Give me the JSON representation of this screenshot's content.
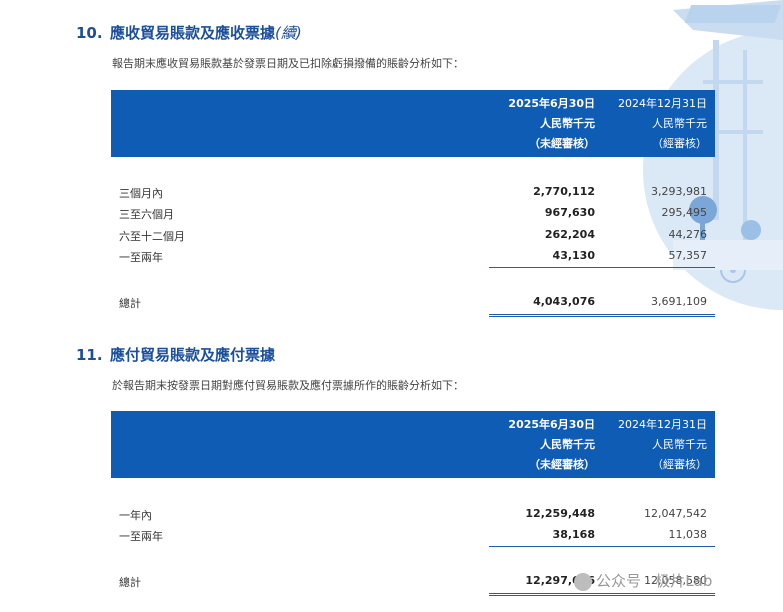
{
  "section10": {
    "number": "10.",
    "title": "應收貿易賬款及應收票據",
    "continued": "(續)",
    "intro": "報告期末應收貿易賬款基於發票日期及已扣除虧損撥備的賬齡分析如下：",
    "header": {
      "col1": [
        "2025年6月30日",
        "人民幣千元",
        "（未經審核）"
      ],
      "col2": [
        "2024年12月31日",
        "人民幣千元",
        "（經審核）"
      ]
    },
    "rows": [
      {
        "label": "三個月內",
        "v1": "2,770,112",
        "v2": "3,293,981"
      },
      {
        "label": "三至六個月",
        "v1": "967,630",
        "v2": "295,495"
      },
      {
        "label": "六至十二個月",
        "v1": "262,204",
        "v2": "44,276"
      },
      {
        "label": "一至兩年",
        "v1": "43,130",
        "v2": "57,357"
      }
    ],
    "total": {
      "label": "總計",
      "v1": "4,043,076",
      "v2": "3,691,109"
    }
  },
  "section11": {
    "number": "11.",
    "title": "應付貿易賬款及應付票據",
    "intro": "於報告期末按發票日期對應付貿易賬款及應付票據所作的賬齡分析如下：",
    "header": {
      "col1": [
        "2025年6月30日",
        "人民幣千元",
        "（未經審核）"
      ],
      "col2": [
        "2024年12月31日",
        "人民幣千元",
        "（經審核）"
      ]
    },
    "rows": [
      {
        "label": "一年內",
        "v1": "12,259,448",
        "v2": "12,047,542"
      },
      {
        "label": "一至兩年",
        "v1": "38,168",
        "v2": "11,038"
      }
    ],
    "total": {
      "label": "總計",
      "v1": "12,297,616",
      "v2": "12,058,580"
    }
  },
  "watermark": {
    "text": "公众号 · 极片Lab",
    "icon": "wechat-icon"
  }
}
